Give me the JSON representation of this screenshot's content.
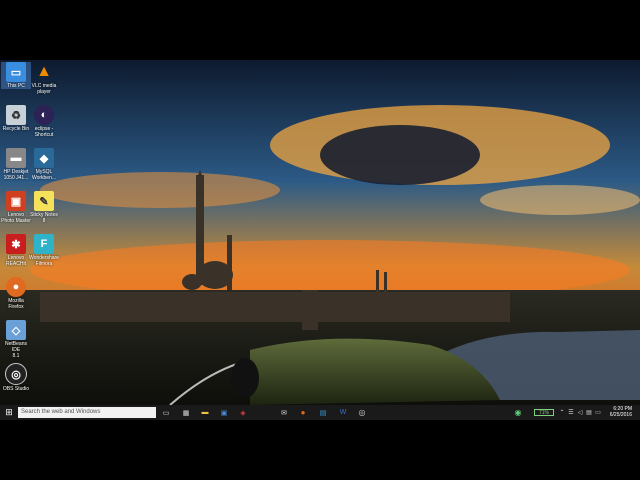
{
  "desktop_icons": [
    {
      "label": "This PC",
      "icon": "this-pc-icon",
      "selected": true
    },
    {
      "label": "VLC media\nplayer",
      "icon": "vlc-icon"
    },
    {
      "label": "Recycle Bin",
      "icon": "recycle-bin-icon"
    },
    {
      "label": "eclipse -\nShortcut",
      "icon": "eclipse-icon"
    },
    {
      "label": "HP Deskjet\n1050 J41...",
      "icon": "printer-icon"
    },
    {
      "label": "MySQL\nWorkben...",
      "icon": "mysql-icon"
    },
    {
      "label": "Lenovo\nPhoto Master",
      "icon": "lenovo-photo-icon"
    },
    {
      "label": "Sticky Notes\n8",
      "icon": "sticky-notes-icon"
    },
    {
      "label": "Lenovo\nREACHit",
      "icon": "lenovo-reachit-icon"
    },
    {
      "label": "Wondershare\nFilmora",
      "icon": "filmora-icon"
    },
    {
      "label": "Mozilla\nFirefox",
      "icon": "firefox-icon"
    },
    {
      "label": "NetBeans IDE\n8.1",
      "icon": "netbeans-icon"
    },
    {
      "label": "OBS Studio",
      "icon": "obs-icon"
    }
  ],
  "taskbar": {
    "search_placeholder": "Search the web and Windows",
    "battery_label": "71%",
    "time": "6:20 PM",
    "date": "6/25/2016"
  },
  "colors": {
    "taskbar": "#1a1a1a",
    "accent": "#1e90ff"
  }
}
